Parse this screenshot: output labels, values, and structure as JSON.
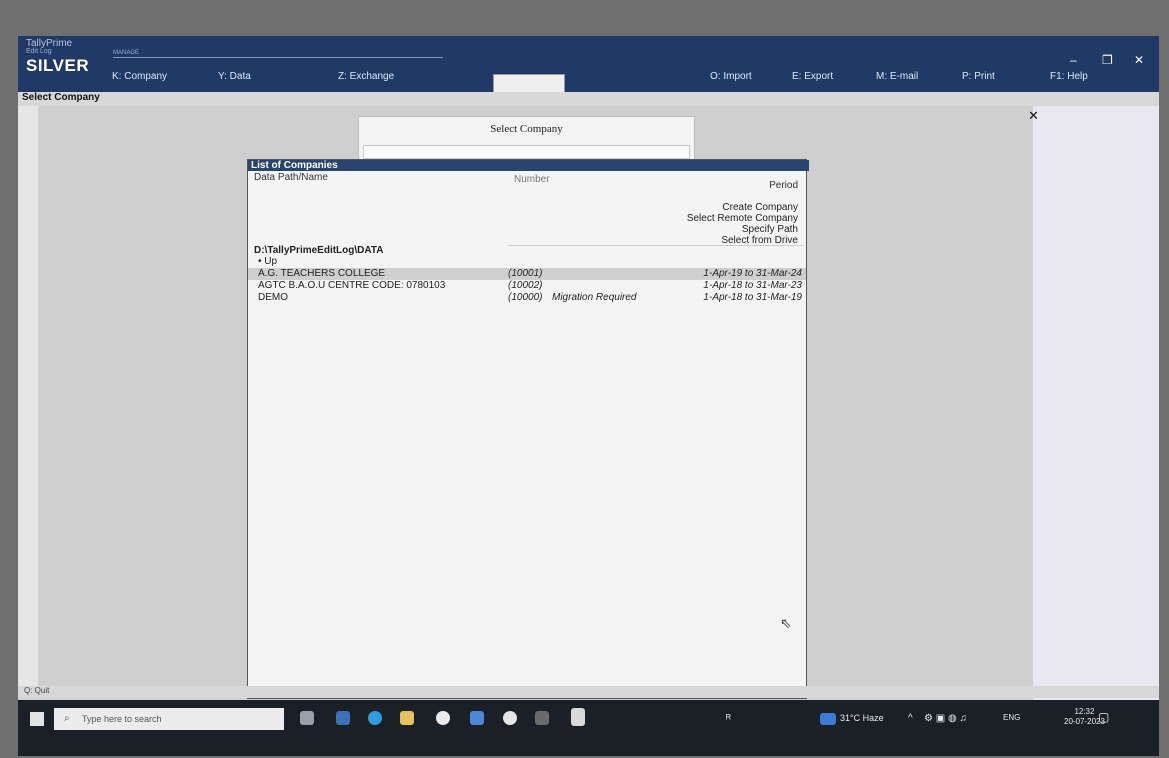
{
  "app": {
    "name": "TallyPrime",
    "edition": "Edit Log",
    "plan": "SILVER",
    "manage": "MANAGE",
    "screen_title": "Select Company"
  },
  "menu": [
    {
      "label": "K: Company"
    },
    {
      "label": "Y: Data"
    },
    {
      "label": "Z: Exchange"
    },
    {
      "label": "O: Import"
    },
    {
      "label": "E: Export"
    },
    {
      "label": "M: E-mail"
    },
    {
      "label": "P: Print"
    },
    {
      "label": "F1: Help"
    }
  ],
  "window_controls": {
    "minimize": "–",
    "restore": "❐",
    "close": "✕"
  },
  "select_box": {
    "title": "Select Company"
  },
  "panel": {
    "title": "List of Companies",
    "col_name": "Data Path/Name",
    "col_number": "Number",
    "col_period": "Period",
    "options": [
      "Create Company",
      "Select Remote Company",
      "Specify Path",
      "Select from Drive"
    ],
    "path": "D:\\TallyPrimeEditLog\\DATA",
    "up_label": "• Up",
    "companies": [
      {
        "name": "A.G. TEACHERS COLLEGE",
        "number": "(10001)",
        "note": "",
        "period": "1-Apr-19 to 31-Mar-24"
      },
      {
        "name": "AGTC B.A.O.U CENTRE CODE: 0780103",
        "number": "(10002)",
        "note": "",
        "period": "1-Apr-18 to 31-Mar-23"
      },
      {
        "name": "DEMO",
        "number": "(10000)",
        "note": "Migration Required",
        "period": "1-Apr-18 to 31-Mar-19"
      }
    ]
  },
  "bottom": {
    "quit": "Q: Quit"
  },
  "taskbar": {
    "search_placeholder": "Type here to search",
    "weather": "31°C Haze",
    "lang": "ENG",
    "time": "12:32",
    "date": "20-07-2023"
  }
}
